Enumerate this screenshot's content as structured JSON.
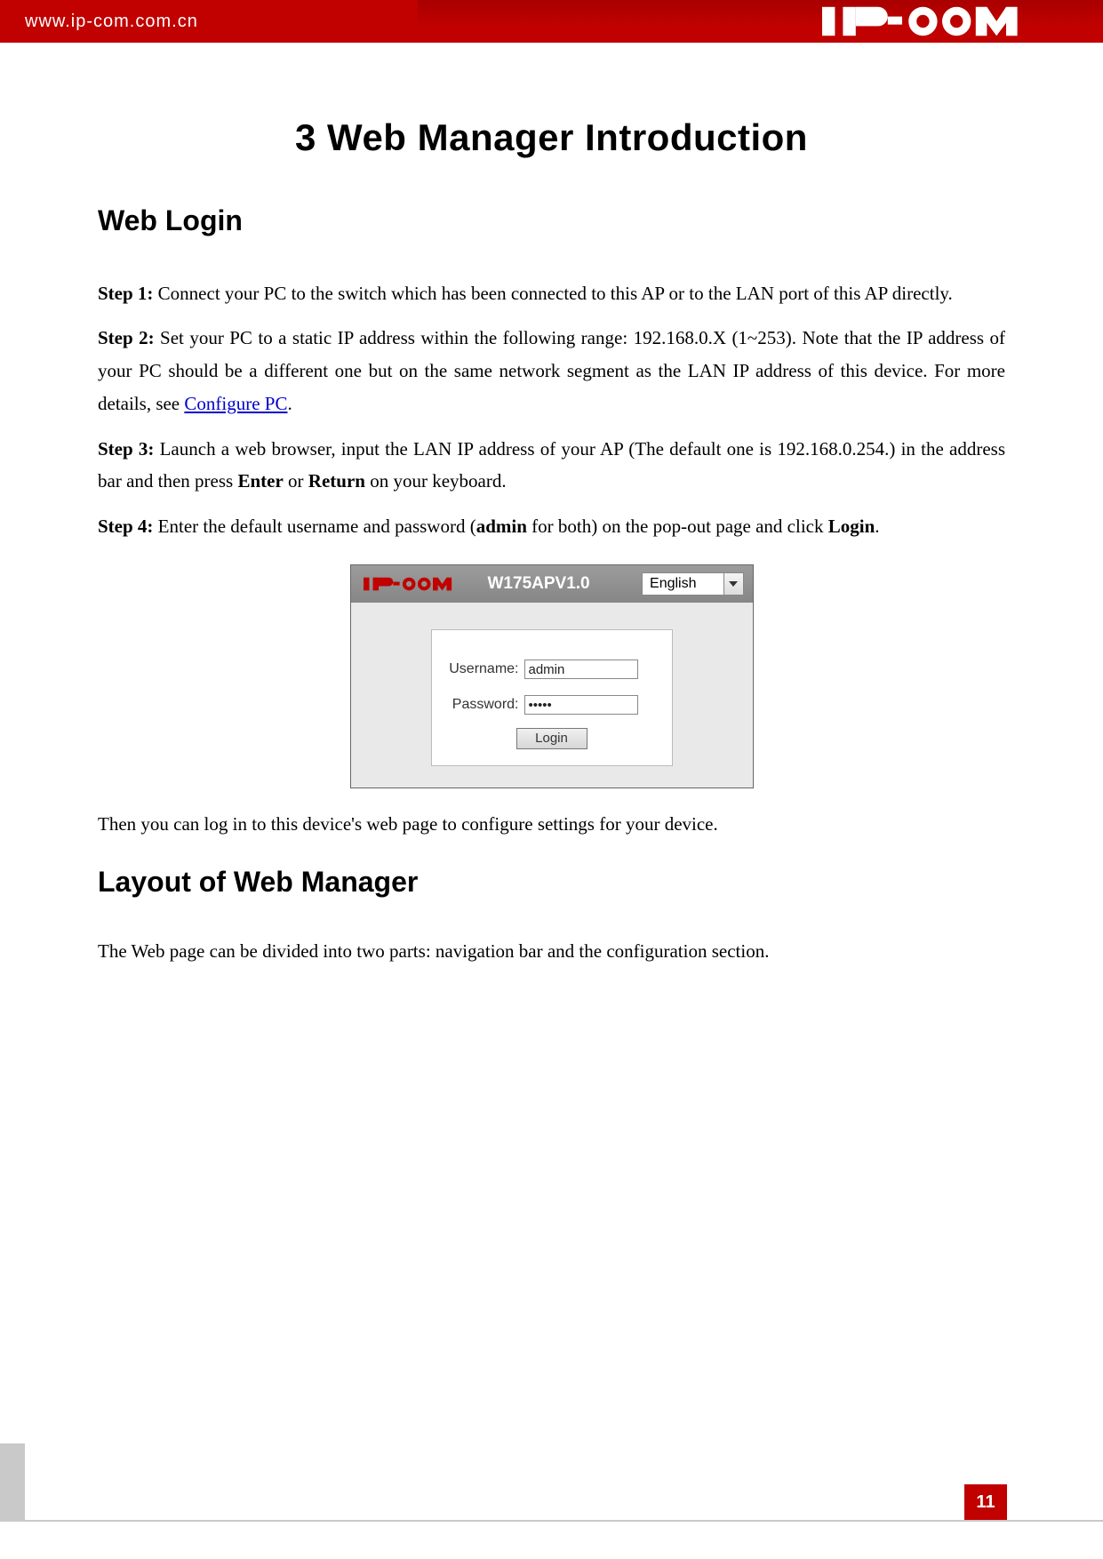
{
  "header": {
    "url": "www.ip-com.com.cn",
    "brand": "IP-COM"
  },
  "title": "3 Web Manager Introduction",
  "section1": {
    "heading": "Web Login",
    "steps": {
      "s1_label": "Step 1:",
      "s1_text": " Connect your PC to the switch which has been connected to this AP or to the LAN port of this AP directly.",
      "s2_label": "Step 2:",
      "s2_text_a": " Set your PC to a static IP address within the following range: 192.168.0.X (1~253). Note that the IP address of your PC should be a different one but on the same network segment as the LAN IP address of this device. For more details, see ",
      "s2_link": "Configure PC",
      "s2_text_b": ".",
      "s3_label": "Step 3:",
      "s3_text_a": " Launch a web browser, input the LAN IP address of your AP (The default one is 192.168.0.254.) in the address bar and then press ",
      "s3_bold1": "Enter",
      "s3_text_b": " or ",
      "s3_bold2": "Return",
      "s3_text_c": " on your keyboard.",
      "s4_label": "Step 4:",
      "s4_text_a": " Enter the default username and password (",
      "s4_bold1": "admin",
      "s4_text_b": " for both) on the pop-out page and click ",
      "s4_bold2": "Login",
      "s4_text_c": "."
    },
    "after_fig": "Then you can log in to this device's web page to configure settings for your device."
  },
  "login_ui": {
    "model": "W175APV1.0",
    "language": "English",
    "username_label": "Username:",
    "username_value": "admin",
    "password_label": "Password:",
    "password_value": "•••••",
    "login_button": "Login"
  },
  "section2": {
    "heading": "Layout of Web Manager",
    "text": "The Web page can be divided into two parts: navigation bar and the configuration section."
  },
  "page_number": "11"
}
